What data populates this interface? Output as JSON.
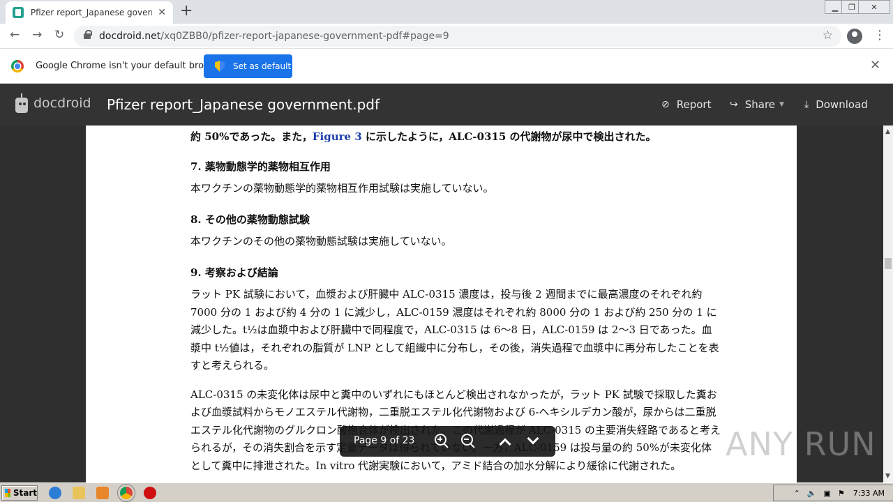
{
  "browser": {
    "tab_title": "Pfizer report_Japanese government",
    "url_domain": "docdroid.net",
    "url_path": "/xq0ZBB0/pfizer-report-japanese-government-pdf#page=9"
  },
  "infobar": {
    "message": "Google Chrome isn't your default browser",
    "button_label": "Set as default"
  },
  "docdroid": {
    "brand": "docdroid",
    "doc_title": "Pfizer report_Japanese government.pdf",
    "report_label": "Report",
    "share_label": "Share",
    "download_label": "Download"
  },
  "document": {
    "p0_pre": "約 50%であった。また，",
    "p0_link": "Figure 3",
    "p0_post": " に示したように，ALC-0315 の代謝物が尿中で検出された。",
    "h7": "7. 薬物動態学的薬物相互作用",
    "p7": "本ワクチンの薬物動態学的薬物相互作用試験は実施していない。",
    "h8": "8. その他の薬物動態試験",
    "p8": "本ワクチンのその他の薬物動態試験は実施していない。",
    "h9": "9. 考察および結論",
    "p9": "ラット PK 試験において，血漿および肝臓中 ALC-0315 濃度は，投与後 2 週間までに最高濃度のそれぞれ約 7000 分の 1 および約 4 分の 1 に減少し，ALC-0159 濃度はそれぞれ約 8000 分の 1 および約 250 分の 1 に減少した。t½は血漿中および肝臓中で同程度で，ALC-0315 は 6～8 日，ALC-0159 は 2～3 日であった。血漿中 t½値は，それぞれの脂質が LNP として組織中に分布し，その後，消失過程で血漿中に再分布したことを表すと考えられる。",
    "p10": "ALC-0315 の未変化体は尿中と糞中のいずれにもほとんど検出されなかったが，ラット PK 試験で採取した糞および血漿試料からモノエステル代謝物，二重脱エステル化代謝物および 6-ヘキシルデカン酸が，尿からは二重脱エステル化代謝物のグルクロン酸抱合体が検出された。この代謝過程が ALC-0315 の主要消失経路であると考えられるが，その消失割合を示す定量データは得られていない。一方，ALC-0159 は投与量の約 50%が未変化体として糞中に排泄された。In vitro 代謝実験において，アミド結合の加水分解により緩徐に代謝された。"
  },
  "pager": {
    "label": "Page 9 of 23"
  },
  "watermark": "ANY RUN",
  "taskbar": {
    "start_label": "Start",
    "clock": "7:33 AM"
  }
}
